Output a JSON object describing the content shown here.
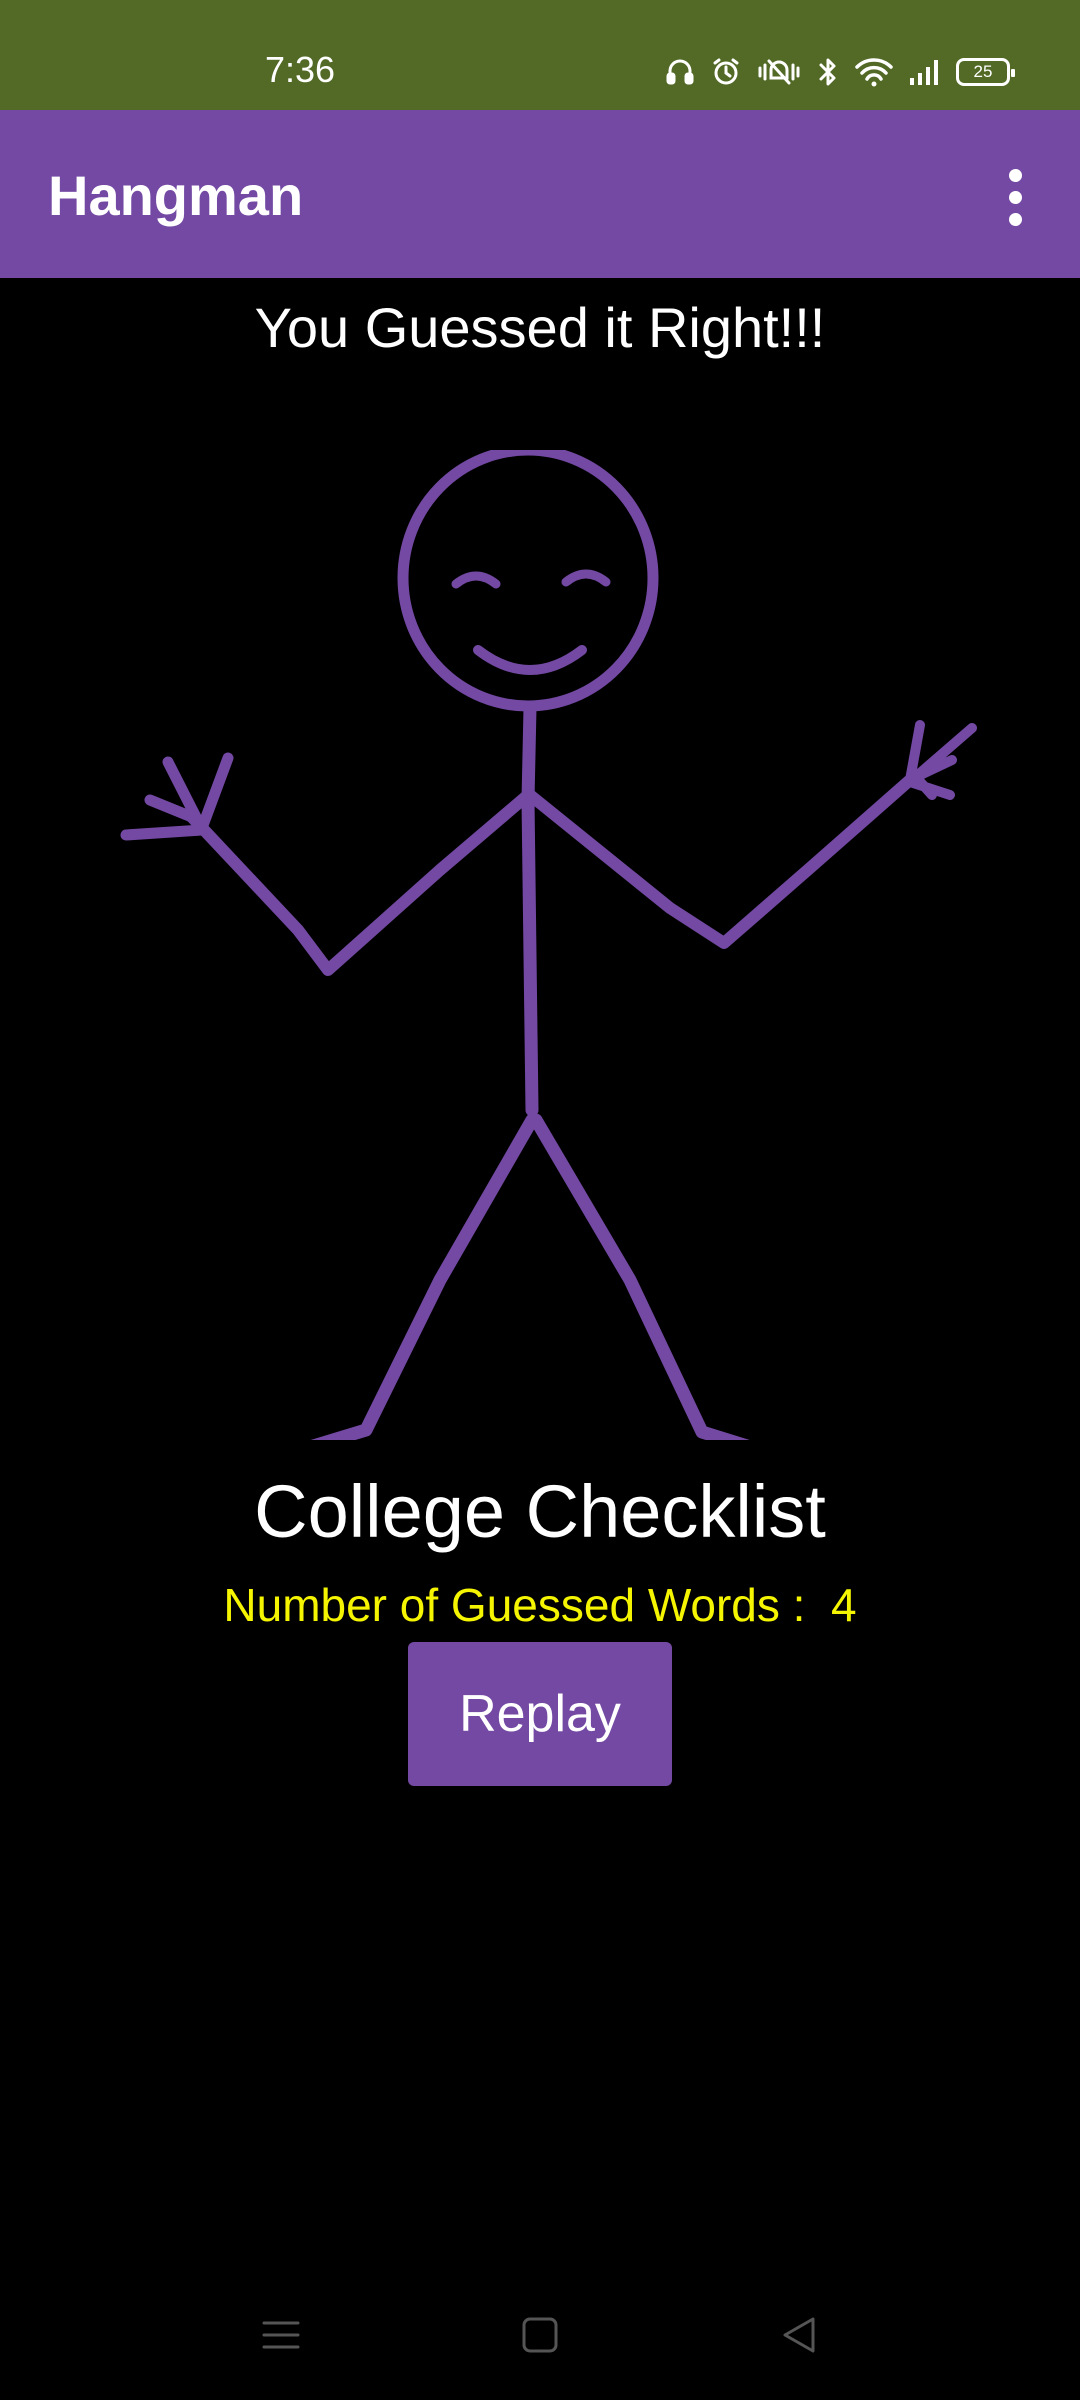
{
  "status_bar": {
    "time": "7:36",
    "battery": "25",
    "icons": [
      "headphones-icon",
      "alarm-icon",
      "vibrate-off-icon",
      "bluetooth-icon",
      "wifi-icon",
      "signal-icon",
      "battery-icon"
    ]
  },
  "app_bar": {
    "title": "Hangman",
    "menu_icon": "more-vert-icon"
  },
  "main": {
    "result_message": "You Guessed it Right!!!",
    "category": "College Checklist",
    "guessed_label": "Number of Guessed Words :",
    "guessed_count": "4",
    "replay_label": "Replay",
    "illustration": "happy-stick-figure"
  },
  "nav_bar": {
    "buttons": [
      "menu-icon",
      "home-icon",
      "back-icon"
    ]
  },
  "colors": {
    "status_bar": "#526a26",
    "app_bar": "#7349a3",
    "accent": "#7349a3",
    "background": "#000000",
    "count_text": "#f6f500",
    "text": "#ffffff"
  }
}
